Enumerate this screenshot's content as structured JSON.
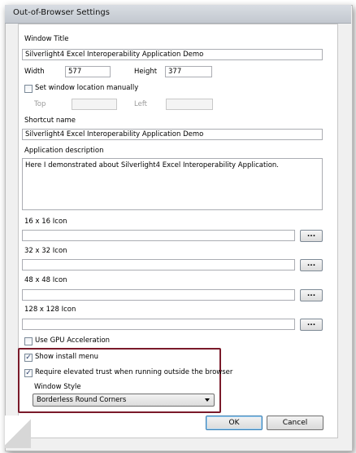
{
  "window": {
    "title": "Out-of-Browser Settings"
  },
  "form": {
    "window_title_label": "Window Title",
    "window_title_value": "Silverlight4 Excel Interoperability Application Demo",
    "width_label": "Width",
    "width_value": "577",
    "height_label": "Height",
    "height_value": "377",
    "set_location_label": "Set window location manually",
    "set_location_checked": false,
    "top_label": "Top",
    "top_value": "",
    "left_label": "Left",
    "left_value": "",
    "shortcut_label": "Shortcut name",
    "shortcut_value": "Silverlight4 Excel Interoperability Application Demo",
    "description_label": "Application description",
    "description_value": "Here I demonstrated about Silverlight4 Excel Interoperability Application.",
    "icon16_label": "16 x 16 Icon",
    "icon32_label": "32 x 32 Icon",
    "icon48_label": "48 x 48 Icon",
    "icon128_label": "128 x 128 Icon",
    "browse_label": "...",
    "gpu_label": "Use GPU Acceleration",
    "gpu_checked": false,
    "show_install_label": "Show install menu",
    "show_install_checked": true,
    "elevated_label": "Require elevated trust when running outside the browser",
    "elevated_checked": true,
    "window_style_label": "Window Style",
    "window_style_value": "Borderless Round Corners"
  },
  "buttons": {
    "ok": "OK",
    "cancel": "Cancel"
  },
  "colors": {
    "highlight_border": "#7a1a2a",
    "ok_focus": "#3c7fb1"
  },
  "icons": {
    "check": "✓"
  }
}
